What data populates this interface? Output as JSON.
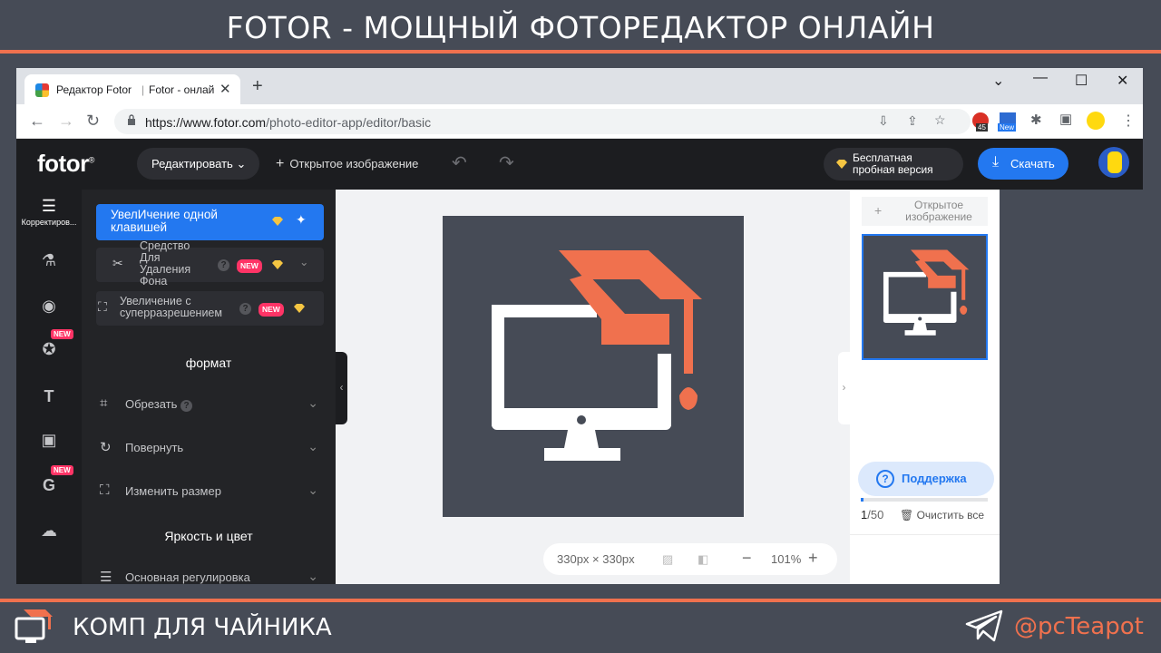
{
  "banner": {
    "title": "FOTOR - МОЩНЫЙ ФОТОРЕДАКТОР ОНЛАЙН",
    "footer_left": "КОМП ДЛЯ ЧАЙНИКА",
    "footer_right": "@pcTeapot",
    "accent": "#f0714e"
  },
  "browser": {
    "tab_title_1": "Редактор Fotor",
    "tab_title_2": "Fotor - онлай",
    "url_host": "https://www.fotor.com",
    "url_path": "/photo-editor-app/editor/basic",
    "ext_badge_1": "45",
    "ext_badge_2": "New"
  },
  "fotor": {
    "logo": "fotor",
    "logo_mark": "®",
    "edit_label": "Редактировать",
    "open_image_label": "Открытое изображение",
    "trial_line1": "Бесплатная",
    "trial_line2": "пробная версия",
    "download_label": "Скачать",
    "accent": "#2378f0"
  },
  "rail": {
    "active_label": "Корректиров...",
    "new_badge": "NEW"
  },
  "panel": {
    "one_click": "УвелИчение одной клавишей",
    "bg_remover": "Средство Для Удаления Фона",
    "super_res": "Увеличение с суперразрешением",
    "new_badge": "NEW",
    "section_format": "формат",
    "crop": "Обрезать",
    "rotate": "Повернуть",
    "resize": "Изменить размер",
    "section_color": "Яркость и цвет",
    "basic_adjust": "Основная регулировка"
  },
  "canvas": {
    "dimensions": "330px × 330px",
    "zoom": "101%"
  },
  "right": {
    "open_image": "Открытое изображение",
    "support": "Поддержка",
    "count_current": "1",
    "count_total": "/50",
    "clear_all": "Очистить все",
    "progress_fraction": 0.02
  }
}
